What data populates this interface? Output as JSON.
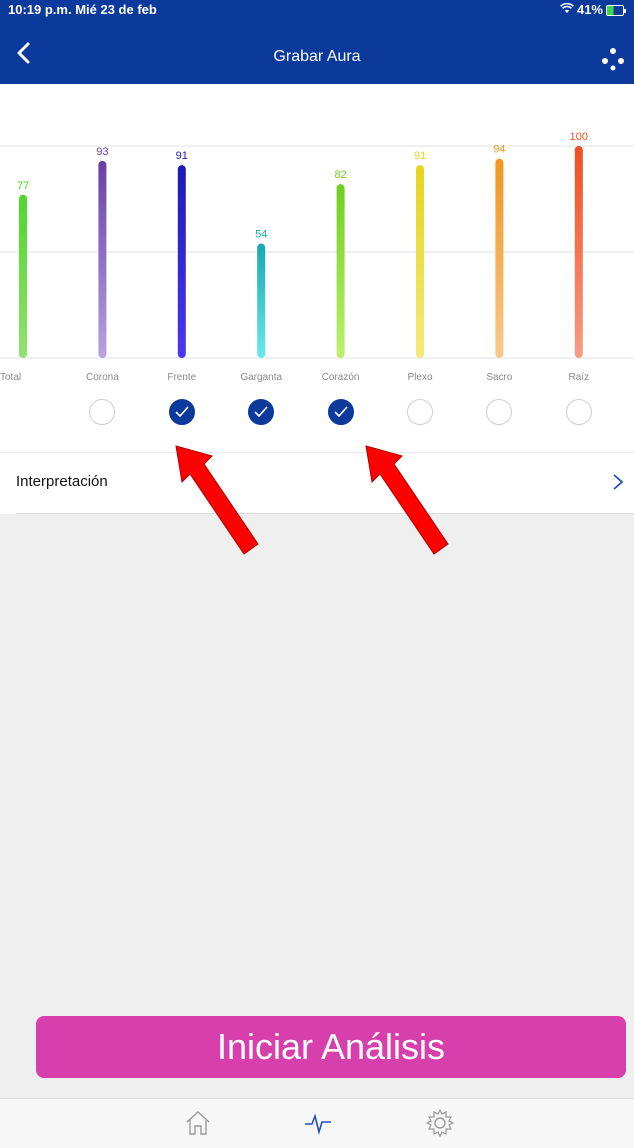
{
  "status": {
    "time": "10:19 p.m.  Mié 23 de feb",
    "battery": "41%"
  },
  "nav": {
    "title": "Grabar Aura"
  },
  "chart_data": {
    "type": "bar",
    "categories": [
      "Total",
      "Corona",
      "Frente",
      "Garganta",
      "Corazón",
      "Plexo",
      "Sacro",
      "Raíz"
    ],
    "values": [
      77,
      93,
      91,
      54,
      82,
      91,
      94,
      100
    ],
    "ylim": [
      0,
      100
    ],
    "grid": true,
    "colors": [
      [
        "#4fd62a",
        "#8fe36e"
      ],
      [
        "#6a3fa6",
        "#b8a2e0"
      ],
      [
        "#1c1ab4",
        "#4b38f0"
      ],
      [
        "#16a8b0",
        "#6be9ea"
      ],
      [
        "#6fcf1c",
        "#bdf06f"
      ],
      [
        "#e6d41b",
        "#f4ea7a"
      ],
      [
        "#f2951e",
        "#f8c98c"
      ],
      [
        "#f04e21",
        "#fa9b84"
      ]
    ],
    "selected": [
      false,
      false,
      true,
      true,
      true,
      false,
      false,
      false
    ]
  },
  "interp": {
    "label": "Interpretación"
  },
  "cta": {
    "label": "Iniciar Análisis"
  },
  "tabs": [
    {
      "icon": "home-icon"
    },
    {
      "icon": "pulse-icon"
    },
    {
      "icon": "gear-icon"
    }
  ]
}
